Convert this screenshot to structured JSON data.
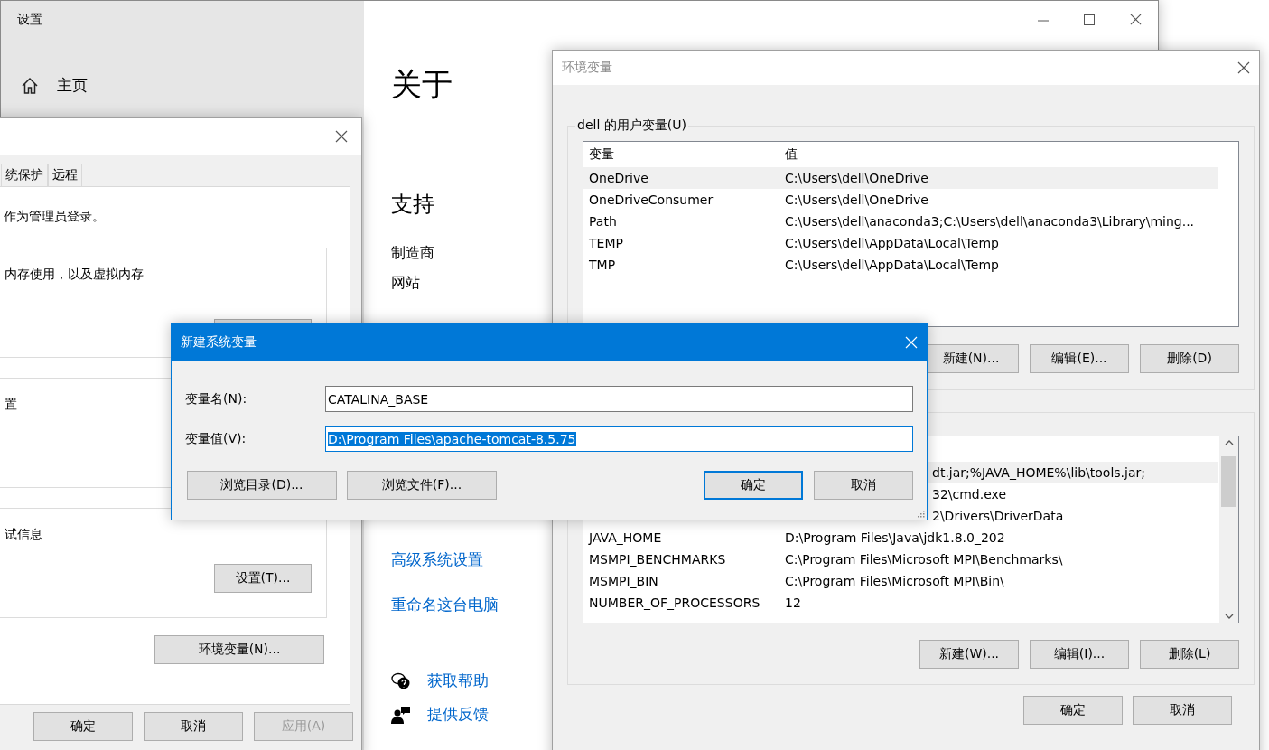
{
  "settings_window": {
    "title": "设置",
    "nav": [
      {
        "label": "主页"
      }
    ],
    "heading": "关于",
    "support_heading": "支持",
    "support_rows": [
      {
        "label": "制造商"
      },
      {
        "label": "网站"
      }
    ],
    "related_links": [
      {
        "label": "高级系统设置"
      },
      {
        "label": "重命名这台电脑"
      }
    ],
    "help_links": [
      {
        "kind": "help",
        "label": "获取帮助"
      },
      {
        "kind": "feedback",
        "label": "提供反馈"
      }
    ]
  },
  "system_properties": {
    "tabs": [
      {
        "label": "统保护",
        "selected": false
      },
      {
        "label": "远程",
        "selected": false
      }
    ],
    "admin_note": "作为管理员登录。",
    "groups": [
      {
        "kind": "button_cut",
        "text": "内存使用，以及虚拟内存"
      },
      {
        "kind": "text_only",
        "text": "置"
      },
      {
        "kind": "with_button",
        "text": "试信息",
        "button": "设置(T)..."
      }
    ],
    "env_button": "环境变量(N)...",
    "buttons": [
      {
        "label": "确定",
        "disabled": false
      },
      {
        "label": "取消",
        "disabled": false
      },
      {
        "label": "应用(A)",
        "disabled": true
      }
    ]
  },
  "env_window": {
    "title": "环境变量",
    "active": false,
    "user_group": {
      "label": "dell 的用户变量(U)",
      "columns": [
        "变量",
        "值"
      ],
      "rows": [
        {
          "name": "OneDrive",
          "value": "C:\\Users\\dell\\OneDrive",
          "selected": true
        },
        {
          "name": "OneDriveConsumer",
          "value": "C:\\Users\\dell\\OneDrive",
          "selected": false
        },
        {
          "name": "Path",
          "value": "C:\\Users\\dell\\anaconda3;C:\\Users\\dell\\anaconda3\\Library\\ming...",
          "selected": false
        },
        {
          "name": "TEMP",
          "value": "C:\\Users\\dell\\AppData\\Local\\Temp",
          "selected": false
        },
        {
          "name": "TMP",
          "value": "C:\\Users\\dell\\AppData\\Local\\Temp",
          "selected": false
        }
      ],
      "buttons": [
        "新建(N)...",
        "编辑(E)...",
        "删除(D)"
      ]
    },
    "system_group": {
      "rows": [
        {
          "kind": "partial",
          "value": "dt.jar;%JAVA_HOME%\\lib\\tools.jar;",
          "selected": true
        },
        {
          "kind": "partial",
          "value": "32\\cmd.exe",
          "selected": false
        },
        {
          "kind": "partial",
          "value": "2\\Drivers\\DriverData",
          "selected": false
        },
        {
          "kind": "full",
          "name": "JAVA_HOME",
          "value": "D:\\Program Files\\Java\\jdk1.8.0_202",
          "selected": false
        },
        {
          "kind": "full",
          "name": "MSMPI_BENCHMARKS",
          "value": "C:\\Program Files\\Microsoft MPI\\Benchmarks\\",
          "selected": false
        },
        {
          "kind": "full",
          "name": "MSMPI_BIN",
          "value": "C:\\Program Files\\Microsoft MPI\\Bin\\",
          "selected": false
        },
        {
          "kind": "full",
          "name": "NUMBER_OF_PROCESSORS",
          "value": "12",
          "selected": false
        }
      ],
      "buttons": [
        "新建(W)...",
        "编辑(I)...",
        "删除(L)"
      ]
    },
    "buttons": [
      "确定",
      "取消"
    ]
  },
  "new_variable_dialog": {
    "title": "新建系统变量",
    "fields": [
      {
        "label": "变量名(N):",
        "value": "CATALINA_BASE",
        "selected": false
      },
      {
        "label": "变量值(V):",
        "value": "D:\\Program Files\\apache-tomcat-8.5.75",
        "selected": true
      }
    ],
    "buttons": [
      {
        "kind": "browse",
        "label": "浏览目录(D)...",
        "default": false
      },
      {
        "kind": "browse",
        "label": "浏览文件(F)...",
        "default": false
      },
      {
        "kind": "action",
        "label": "确定",
        "default": true
      },
      {
        "kind": "action",
        "label": "取消",
        "default": false
      }
    ]
  }
}
